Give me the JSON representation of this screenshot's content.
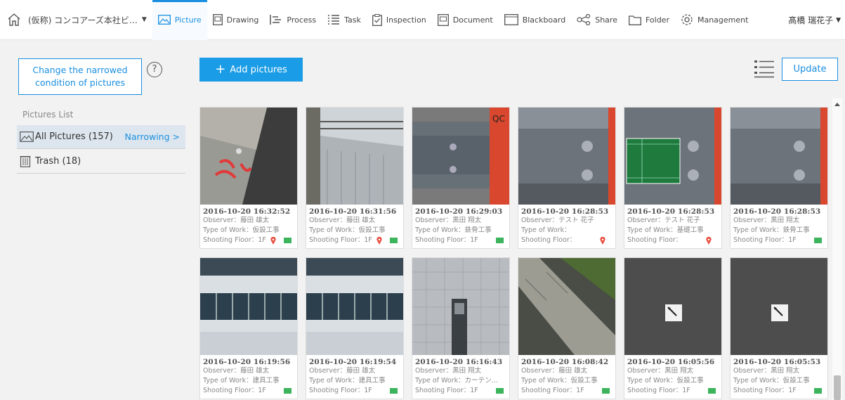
{
  "nav": {
    "project": "(仮称) コンコアーズ本社ビ…",
    "tabs": [
      {
        "label": "Picture",
        "icon": "picture-icon",
        "active": true
      },
      {
        "label": "Drawing",
        "icon": "drawing-icon"
      },
      {
        "label": "Process",
        "icon": "process-icon"
      },
      {
        "label": "Task",
        "icon": "task-icon"
      },
      {
        "label": "Inspection",
        "icon": "inspection-icon"
      },
      {
        "label": "Document",
        "icon": "document-icon"
      },
      {
        "label": "Blackboard",
        "icon": "blackboard-icon"
      },
      {
        "label": "Share",
        "icon": "share-icon"
      },
      {
        "label": "Folder",
        "icon": "folder-icon"
      },
      {
        "label": "Management",
        "icon": "gear-icon"
      }
    ],
    "user": "髙橋 瑞花子"
  },
  "sidebar": {
    "narrow_button": "Change the narrowed condition of pictures",
    "help": "?",
    "list_title": "Pictures List",
    "items": [
      {
        "label": "All Pictures (157)",
        "extra": "Narrowing >"
      },
      {
        "label": "Trash (18)"
      }
    ]
  },
  "toolbar": {
    "add_label": "Add pictures",
    "add_plus": "+",
    "update_label": "Update"
  },
  "photos": [
    {
      "date": "2016-10-20 16:32:52",
      "observer": "Observer：藤田 雄太",
      "work": "Type of Work：仮設工事",
      "floor": "Shooting Floor：1F",
      "pin": true,
      "flag": true,
      "scene": "asphalt-red"
    },
    {
      "date": "2016-10-20 16:31:56",
      "observer": "Observer：藤田 雄太",
      "work": "Type of Work：仮設工事",
      "floor": "Shooting Floor：1F",
      "pin": true,
      "flag": true,
      "scene": "scaffold"
    },
    {
      "date": "2016-10-20 16:29:03",
      "observer": "Observer：黒田 翔太",
      "work": "Type of Work：鉄骨工事",
      "floor": "Shooting Floor：1F",
      "pin": false,
      "flag": true,
      "scene": "steel-red"
    },
    {
      "date": "2016-10-20 16:28:53",
      "observer": "Observer：テスト 花子",
      "work": "Type of Work：",
      "floor": "Shooting Floor：",
      "pin": true,
      "flag": false,
      "scene": "steel"
    },
    {
      "date": "2016-10-20 16:28:53",
      "observer": "Observer：テスト 花子",
      "work": "Type of Work：基礎工事",
      "floor": "Shooting Floor：",
      "pin": true,
      "flag": false,
      "scene": "steel-board"
    },
    {
      "date": "2016-10-20 16:28:53",
      "observer": "Observer：黒田 翔太",
      "work": "Type of Work：鉄骨工事",
      "floor": "Shooting Floor：1F",
      "pin": false,
      "flag": true,
      "scene": "steel"
    },
    {
      "date": "2016-10-20 16:19:56",
      "observer": "Observer：藤田 雄太",
      "work": "Type of Work：建具工事",
      "floor": "Shooting Floor：1F",
      "pin": false,
      "flag": true,
      "scene": "building"
    },
    {
      "date": "2016-10-20 16:19:54",
      "observer": "Observer：藤田 雄太",
      "work": "Type of Work：建具工事",
      "floor": "Shooting Floor：1F",
      "pin": false,
      "flag": true,
      "scene": "building"
    },
    {
      "date": "2016-10-20 16:16:43",
      "observer": "Observer：黒田 翔太",
      "work": "Type of Work：カーテン…",
      "floor": "Shooting Floor：1F",
      "pin": false,
      "flag": true,
      "scene": "curtainwall"
    },
    {
      "date": "2016-10-20 16:08:42",
      "observer": "Observer：藤田 雄太",
      "work": "Type of Work：仮設工事",
      "floor": "Shooting Floor：1F",
      "pin": false,
      "flag": true,
      "scene": "curb"
    },
    {
      "date": "2016-10-20 16:05:56",
      "observer": "Observer：黒田 翔太",
      "work": "Type of Work：仮設工事",
      "floor": "Shooting Floor：1F",
      "pin": false,
      "flag": true,
      "scene": "marker"
    },
    {
      "date": "2016-10-20 16:05:53",
      "observer": "Observer：黒田 翔太",
      "work": "Type of Work：仮設工事",
      "floor": "Shooting Floor：1F",
      "pin": false,
      "flag": true,
      "scene": "marker"
    }
  ],
  "colors": {
    "accent": "#1a8fe0",
    "pin": "#e84c3d",
    "flag": "#3bb45c"
  }
}
